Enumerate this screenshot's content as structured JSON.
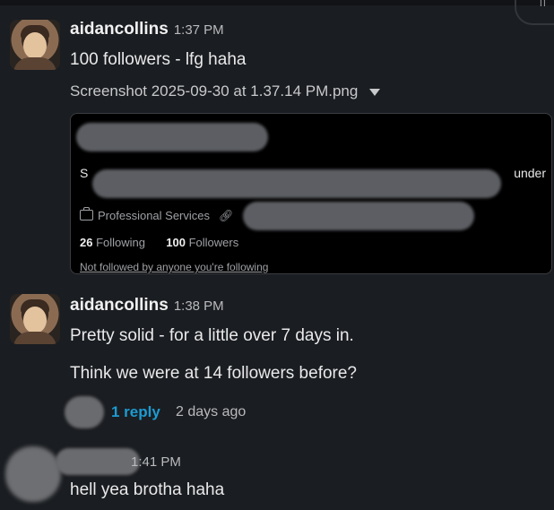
{
  "window": {
    "corner_label": "II"
  },
  "messages": [
    {
      "author": "aidancollins",
      "time": "1:37 PM",
      "text": "100 followers - lfg haha",
      "attachment": {
        "filename": "Screenshot 2025-09-30 at 1.37.14 PM.png",
        "card": {
          "bio_fragment_start": "S",
          "bio_fragment_end": "under",
          "category": "Professional Services",
          "following_count": "26",
          "following_label": "Following",
          "followers_count": "100",
          "followers_label": "Followers",
          "not_followed_note": "Not followed by anyone you're following"
        }
      }
    },
    {
      "author": "aidancollins",
      "time": "1:38 PM",
      "text": "Pretty solid - for a little over 7 days in.",
      "text2": "Think we were at 14 followers before?",
      "thread": {
        "reply_count": "1 reply",
        "last_reply": "2 days ago"
      }
    },
    {
      "time": "1:41 PM",
      "text": "hell yea brotha haha"
    }
  ]
}
